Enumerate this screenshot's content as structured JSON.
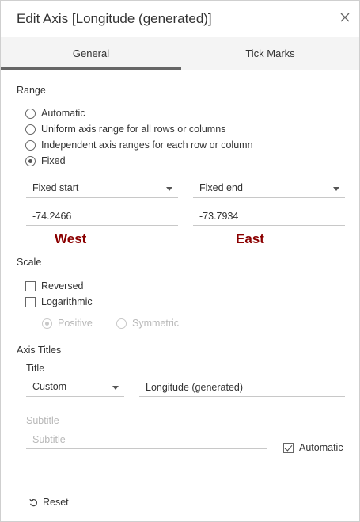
{
  "dialog": {
    "title": "Edit Axis [Longitude (generated)]"
  },
  "tabs": [
    {
      "label": "General",
      "active": true
    },
    {
      "label": "Tick Marks",
      "active": false
    }
  ],
  "range": {
    "heading": "Range",
    "options": [
      {
        "label": "Automatic",
        "selected": false
      },
      {
        "label": "Uniform axis range for all rows or columns",
        "selected": false
      },
      {
        "label": "Independent axis ranges for each row or column",
        "selected": false
      },
      {
        "label": "Fixed",
        "selected": true
      }
    ],
    "start_select": "Fixed start",
    "end_select": "Fixed end",
    "start_value": "-74.2466",
    "end_value": "-73.7934",
    "start_annotation": "West",
    "end_annotation": "East"
  },
  "scale": {
    "heading": "Scale",
    "reversed_label": "Reversed",
    "logarithmic_label": "Logarithmic",
    "positive_label": "Positive",
    "symmetric_label": "Symmetric"
  },
  "axis_titles": {
    "heading": "Axis Titles",
    "title_label": "Title",
    "title_mode": "Custom",
    "title_value": "Longitude (generated)",
    "subtitle_label": "Subtitle",
    "subtitle_placeholder": "Subtitle",
    "automatic_label": "Automatic"
  },
  "footer": {
    "reset_label": "Reset"
  },
  "colors": {
    "annotation": "#8b0000",
    "tab_indicator": "#666666",
    "tab_background": "#f4f4f4"
  }
}
